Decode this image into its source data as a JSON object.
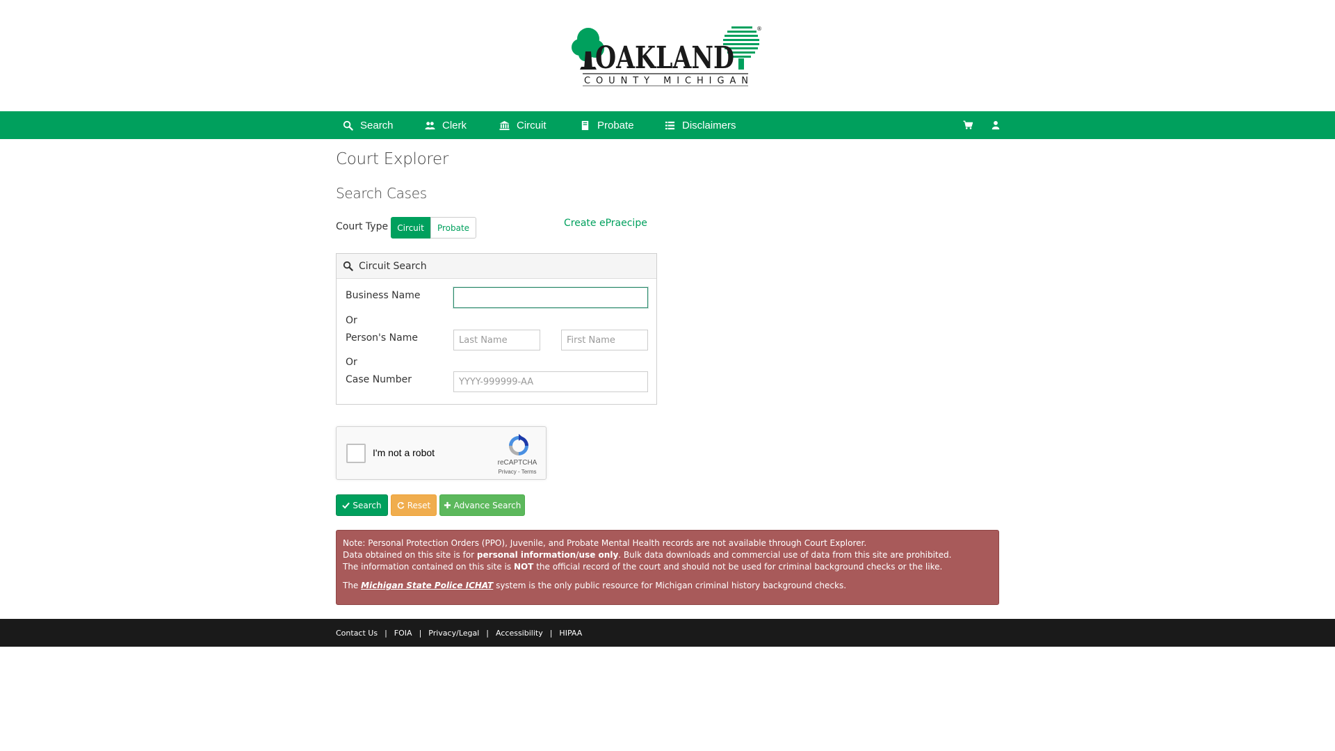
{
  "logo": {
    "name": "OAKLAND",
    "subtitle": "COUNTY MICHIGAN",
    "registered": "®"
  },
  "nav": {
    "items": [
      {
        "label": "Search",
        "icon": "search-icon"
      },
      {
        "label": "Clerk",
        "icon": "users-icon"
      },
      {
        "label": "Circuit",
        "icon": "bank-icon"
      },
      {
        "label": "Probate",
        "icon": "book-icon"
      },
      {
        "label": "Disclaimers",
        "icon": "list-icon"
      }
    ],
    "right_icons": [
      "cart-icon",
      "user-icon"
    ]
  },
  "page": {
    "title": "Court Explorer",
    "section_title": "Search Cases"
  },
  "court_type": {
    "label": "Court Type",
    "options": [
      "Circuit",
      "Probate"
    ],
    "selected": "Circuit"
  },
  "epraecipe_link": "Create ePraecipe",
  "panel": {
    "heading": "Circuit Search",
    "business_name_label": "Business Name",
    "business_name_value": "",
    "or_1": "Or",
    "persons_name_label": "Person's Name",
    "last_name_placeholder": "Last Name",
    "first_name_placeholder": "First Name",
    "or_2": "Or",
    "case_number_label": "Case Number",
    "case_number_placeholder": "YYYY-999999-AA"
  },
  "recaptcha": {
    "label": "I'm not a robot",
    "brand": "reCAPTCHA",
    "terms": "Privacy - Terms"
  },
  "buttons": {
    "search": "Search",
    "reset": "Reset",
    "advance_search": "Advance Search"
  },
  "notice": {
    "line1": "Note: Personal Protection Orders (PPO), Juvenile, and Probate Mental Health records are not available through Court Explorer.",
    "line2_a": "Data obtained on this site is for ",
    "line2_b": "personal information/use only",
    "line2_c": ". Bulk data downloads and commercial use of data from this site are prohibited.",
    "line3_a": "The information contained on this site is ",
    "line3_b": "NOT",
    "line3_c": " the official record of the court and should not be used for criminal background checks or the like.",
    "line4_a": "The ",
    "line4_link": "Michigan State Police ICHAT",
    "line4_c": " system is the only public resource for Michigan criminal history background checks."
  },
  "footer": {
    "links": [
      "Contact Us",
      "FOIA",
      "Privacy/Legal",
      "Accessibility",
      "HIPAA"
    ],
    "separator": "|"
  },
  "colors": {
    "brand_green": "#00a05d",
    "warning_orange": "#f0ad4e",
    "success_green": "#5cb85c",
    "notice_red": "#a85a5a",
    "footer_black": "#1a1a1a"
  }
}
